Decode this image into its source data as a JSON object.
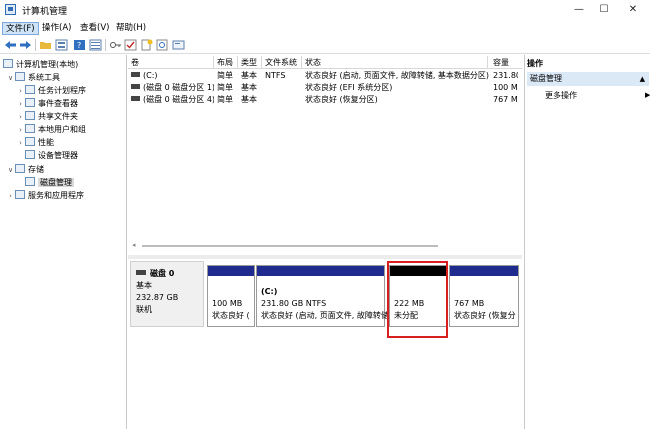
{
  "window": {
    "title": "计算机管理",
    "buttons": {
      "minimize": "—",
      "maximize": "☐",
      "close": "✕"
    }
  },
  "menu": [
    {
      "label": "文件(F)",
      "active": true
    },
    {
      "label": "操作(A)"
    },
    {
      "label": "查看(V)"
    },
    {
      "label": "帮助(H)"
    }
  ],
  "toolbar": [
    "back-icon",
    "forward-icon",
    "folder-icon",
    "properties-icon",
    "help-icon",
    "details-icon",
    "key-icon",
    "check-icon",
    "new-icon",
    "search-icon",
    "console-icon"
  ],
  "tree": [
    {
      "label": "计算机管理(本地)",
      "expander": "",
      "icon": "computer-icon",
      "level": 0
    },
    {
      "label": "系统工具",
      "expander": "∨",
      "icon": "tools-icon",
      "level": 1
    },
    {
      "label": "任务计划程序",
      "expander": "›",
      "icon": "clock-icon",
      "level": 2
    },
    {
      "label": "事件查看器",
      "expander": "›",
      "icon": "event-viewer-icon",
      "level": 2
    },
    {
      "label": "共享文件夹",
      "expander": "›",
      "icon": "shared-folder-icon",
      "level": 2
    },
    {
      "label": "本地用户和组",
      "expander": "›",
      "icon": "users-icon",
      "level": 2
    },
    {
      "label": "性能",
      "expander": "›",
      "icon": "performance-icon",
      "level": 2
    },
    {
      "label": "设备管理器",
      "expander": "",
      "icon": "device-manager-icon",
      "level": 2
    },
    {
      "label": "存储",
      "expander": "∨",
      "icon": "storage-icon",
      "level": 1
    },
    {
      "label": "磁盘管理",
      "expander": "",
      "icon": "disk-icon",
      "level": 2,
      "selected": true
    },
    {
      "label": "服务和应用程序",
      "expander": "›",
      "icon": "services-icon",
      "level": 1
    }
  ],
  "volumes": {
    "headers": [
      "卷",
      "布局",
      "类型",
      "文件系统",
      "状态",
      "容量"
    ],
    "rows": [
      [
        "(C:)",
        "简单",
        "基本",
        "NTFS",
        "状态良好 (启动, 页面文件, 故障转储, 基本数据分区)",
        "231.80"
      ],
      [
        "(磁盘 0 磁盘分区 1)",
        "简单",
        "基本",
        "",
        "状态良好 (EFI 系统分区)",
        "100 MB"
      ],
      [
        "(磁盘 0 磁盘分区 4)",
        "简单",
        "基本",
        "",
        "状态良好 (恢复分区)",
        "767 MB"
      ]
    ]
  },
  "disk": {
    "name": "磁盘 0",
    "type": "基本",
    "size": "232.87 GB",
    "status": "联机",
    "partitions": [
      {
        "name": "",
        "size": "100 MB",
        "status": "状态良好 (",
        "unallocated": false
      },
      {
        "name": "(C:)",
        "size": "231.80 GB NTFS",
        "status": "状态良好 (启动, 页面文件, 故障转储, 基",
        "unallocated": false
      },
      {
        "name": "",
        "size": "222 MB",
        "status": "未分配",
        "unallocated": true
      },
      {
        "name": "",
        "size": "767 MB",
        "status": "状态良好 (恢复分",
        "unallocated": false
      }
    ]
  },
  "actions": {
    "header": "操作",
    "section": "磁盘管理",
    "items": [
      "更多操作"
    ]
  },
  "colors": {
    "partition_bar": "#1f2b8e",
    "unallocated_bar": "#000000",
    "highlight_box": "#d81e1e",
    "selection": "#d9d9d9",
    "action_section": "#dbe8f6"
  }
}
